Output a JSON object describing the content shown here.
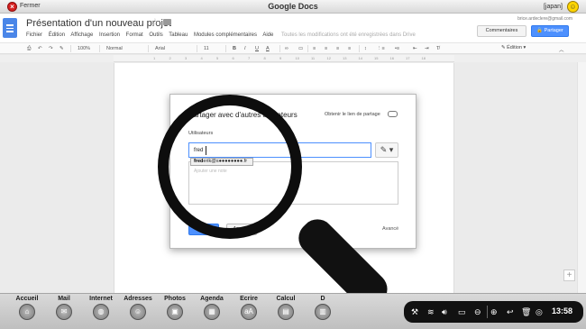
{
  "window": {
    "close_label": "Fermer",
    "title": "Google Docs",
    "user": "[japan]"
  },
  "doc": {
    "title": "Présentation d'un nouveau projet",
    "email": "brice.ardeclere@gmail.com",
    "comments_label": "Commentaires",
    "share_label": "Partager",
    "menu": [
      "Fichier",
      "Édition",
      "Affichage",
      "Insertion",
      "Format",
      "Outils",
      "Tableau",
      "Modules complémentaires",
      "Aide"
    ],
    "save_status": "Toutes les modifications ont été enregistrées dans Drive"
  },
  "toolbar": {
    "zoom": "100%",
    "style": "Normal",
    "font": "Arial",
    "size": "11",
    "bold": "B",
    "italic": "I",
    "underline": "U",
    "text_color": "A",
    "mode": "Édition"
  },
  "ruler": [
    "1",
    "2",
    "3",
    "4",
    "5",
    "6",
    "7",
    "8",
    "9",
    "10",
    "11",
    "12",
    "13",
    "14",
    "15",
    "16",
    "17",
    "18"
  ],
  "dialog": {
    "title": "Partager avec d'autres utilisateurs",
    "get_link": "Obtenir le lien de partage",
    "users_label": "Utilisateurs",
    "input_value": "fred",
    "suggestion_bold": "fred",
    "suggestion_rest": "erik@s●●●●●●●●.fr",
    "textarea_placeholder": "Ajouter une note",
    "send_label": "Envoyer",
    "cancel_label": "Annuler",
    "advanced_label": "Avancé"
  },
  "dock": [
    {
      "label": "Accueil",
      "icon": "home-icon",
      "glyph": "⌂"
    },
    {
      "label": "Mail",
      "icon": "mail-icon",
      "glyph": "✉"
    },
    {
      "label": "Internet",
      "icon": "globe-icon",
      "glyph": "◍"
    },
    {
      "label": "Adresses",
      "icon": "contacts-icon",
      "glyph": "☺"
    },
    {
      "label": "Photos",
      "icon": "photos-icon",
      "glyph": "▣"
    },
    {
      "label": "Agenda",
      "icon": "calendar-icon",
      "glyph": "▦"
    },
    {
      "label": "Ecrire",
      "icon": "write-icon",
      "glyph": "aA"
    },
    {
      "label": "Calcul",
      "icon": "calculator-icon",
      "glyph": "▤"
    },
    {
      "label": "D",
      "icon": "documents-icon",
      "glyph": "▥"
    }
  ],
  "tray": {
    "time": "13:58",
    "icons": [
      "tools-icon",
      "wifi-icon",
      "volume-icon",
      "battery-icon",
      "zoom-out-icon",
      "zoom-in-icon",
      "pointer-icon",
      "trash-icon",
      "help-icon"
    ]
  },
  "colors": {
    "accent_blue": "#4d90fe",
    "dock_bg": "#c8c8c8",
    "close_red": "#d62020"
  }
}
